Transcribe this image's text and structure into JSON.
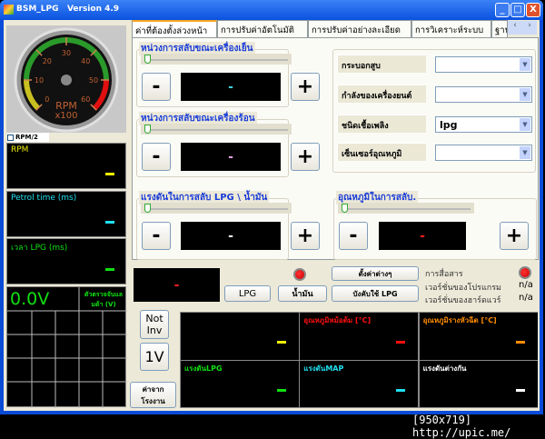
{
  "window": {
    "title": "BSM_LPG",
    "version": "Version 4.9",
    "min": "_",
    "max": "□",
    "close": "X"
  },
  "gauge": {
    "ticks": [
      "0",
      "10",
      "20",
      "30",
      "40",
      "50",
      "60"
    ],
    "unit": "RPM",
    "scale": "x100",
    "value": 0
  },
  "rpm2": {
    "label": "RPM/2",
    "checked": false
  },
  "left_panels": [
    {
      "label": "RPM",
      "color": "#f0f000",
      "value": "-"
    },
    {
      "label": "Petrol time (ms)",
      "color": "#20e0f0",
      "value": "-"
    },
    {
      "label": "เวลา LPG (ms)",
      "color": "#10e010",
      "value": "-"
    }
  ],
  "lambda": {
    "value": "0.0V",
    "label": "ตัวตรวจจับแลมด้า (V)"
  },
  "tabs": [
    "ค่าที่ต้องตั้งล่วงหน้า",
    "การปรับค่าอัตโนมัติ",
    "การปรับค่าอย่างละเอียด",
    "การวิเคราะห์ระบบ",
    "ฐาน"
  ],
  "tab_scroll": {
    "left": "‹",
    "right": "›"
  },
  "groups": [
    {
      "title": "หน่วงการสลับขณะเครื่องเย็น",
      "value": "-",
      "color": "#40d0e0",
      "minus": "-",
      "plus": "+",
      "slider": 0
    },
    {
      "title": "หน่วงการสลับขณะเครื่องร้อน",
      "value": "-",
      "color": "#e0a0e0",
      "minus": "-",
      "plus": "+",
      "slider": 0
    },
    {
      "title": "แรงดันในการสลับ LPG \\ น้ำมัน",
      "value": "-",
      "color": "#ffffff",
      "minus": "-",
      "plus": "+",
      "slider": 0
    },
    {
      "title": "อุณหภูมิในการสลับ.",
      "value": "-",
      "color": "#ff2020",
      "minus": "-",
      "plus": "+",
      "slider": 0
    }
  ],
  "settings": [
    {
      "label": "กระบอกสูบ",
      "value": ""
    },
    {
      "label": "กำลังของเครื่องยนต์",
      "value": ""
    },
    {
      "label": "ชนิดเชื้อเพลิง",
      "value": "lpg"
    },
    {
      "label": "เซ็นเซอร์อุณหภูมิ",
      "value": ""
    }
  ],
  "bottom": {
    "display": "-",
    "lpg": "LPG",
    "petrol": "น้ำมัน",
    "settings_btn": "ตั้งค่าต่างๆ",
    "force_lpg": "บังคับใช้ LPG",
    "comm": "การสื่อสาร",
    "prog_ver": "เวอร์ชั่นของโปรแกรม",
    "hw_ver": "เวอร์ชั่นของฮาร์ดแวร์",
    "prog_val": "n/a",
    "hw_val": "n/a"
  },
  "side_buttons": {
    "not_inv": "Not Inv",
    "volt": "1V",
    "factory": "ค่าจากโรงงาน"
  },
  "panels": [
    {
      "label": "",
      "color": "#f0f000"
    },
    {
      "label": "อุณหภูมิหม้อต้ม [°C]",
      "color": "#ff1010"
    },
    {
      "label": "อุณหภูมิรางหัวฉีด [°C]",
      "color": "#ff8c00"
    },
    {
      "label": "แรงดันLPG",
      "color": "#10e010"
    },
    {
      "label": "แรงดันMAP",
      "color": "#20e0f0"
    },
    {
      "label": "แรงดันต่างกัน",
      "color": "#ffffff"
    }
  ],
  "watermark": "[950x719] http://upic.me/"
}
